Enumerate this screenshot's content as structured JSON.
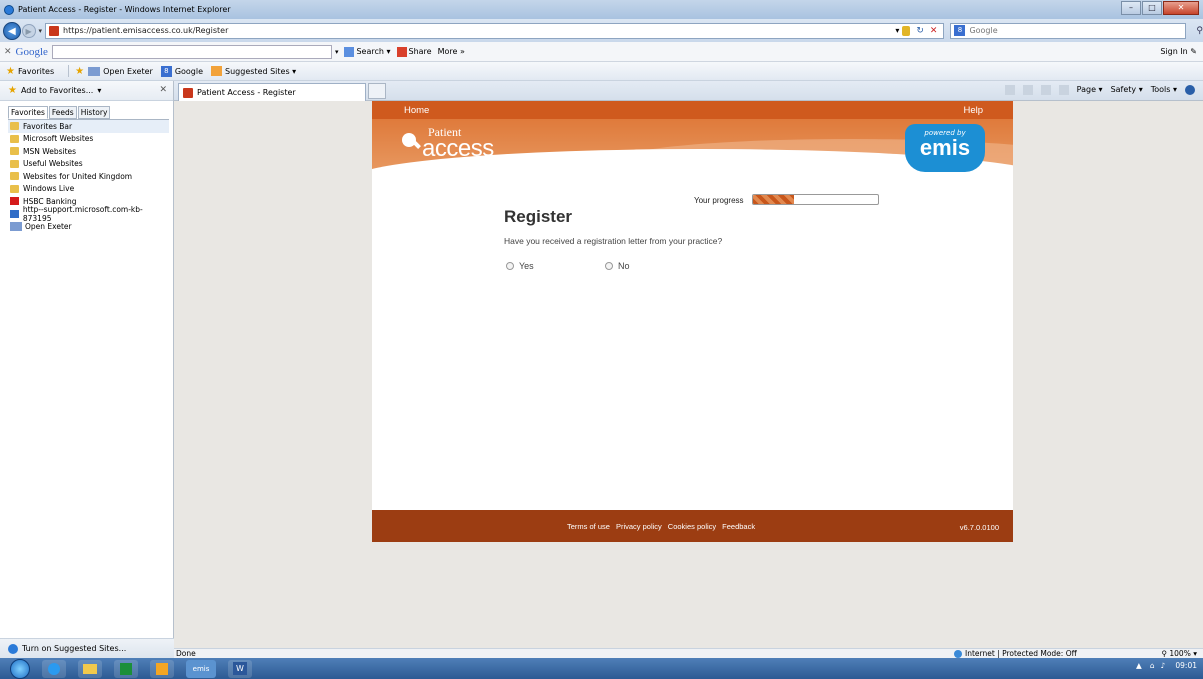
{
  "window": {
    "title": "Patient Access - Register - Windows Internet Explorer"
  },
  "address": {
    "url": "https://patient.emisaccess.co.uk/Register",
    "search_placeholder": "Google"
  },
  "google_toolbar": {
    "logo": "Google",
    "search_label": "Search",
    "share_label": "Share",
    "more_label": "More »",
    "signin_label": "Sign In"
  },
  "favorites_bar": {
    "favorites_label": "Favorites",
    "items": [
      {
        "label": "Open Exeter"
      },
      {
        "label": "Google"
      },
      {
        "label": "Suggested Sites ▾"
      }
    ]
  },
  "fav_pane": {
    "add_label": "Add to Favorites...",
    "tabs": [
      "Favorites",
      "Feeds",
      "History"
    ],
    "items": [
      {
        "label": "Favorites Bar",
        "type": "folder"
      },
      {
        "label": "Microsoft Websites",
        "type": "folder"
      },
      {
        "label": "MSN Websites",
        "type": "folder"
      },
      {
        "label": "Useful Websites",
        "type": "folder"
      },
      {
        "label": "Websites for United Kingdom",
        "type": "folder"
      },
      {
        "label": "Windows Live",
        "type": "folder"
      },
      {
        "label": "HSBC Banking",
        "type": "link"
      },
      {
        "label": "http--support.microsoft.com-kb-873195",
        "type": "link"
      },
      {
        "label": "Open Exeter",
        "type": "link"
      }
    ],
    "footer_label": "Turn on Suggested Sites..."
  },
  "tab": {
    "title": "Patient Access - Register"
  },
  "command_bar": {
    "page_label": "Page ▾",
    "safety_label": "Safety ▾",
    "tools_label": "Tools ▾"
  },
  "site": {
    "nav": {
      "home_label": "Home",
      "help_label": "Help"
    },
    "logo": {
      "patient": "Patient",
      "access": "access"
    },
    "emis_badge": {
      "powered_by": "powered by",
      "brand": "emis"
    },
    "progress": {
      "label": "Your progress",
      "value": 0.33
    },
    "title": "Register",
    "question": "Have you received a registration letter from your practice?",
    "options": {
      "yes": "Yes",
      "no": "No"
    },
    "footer": {
      "links": [
        "Terms of use",
        "Privacy policy",
        "Cookies policy",
        "Feedback"
      ],
      "version": "v6.7.0.0100"
    }
  },
  "status": {
    "text": "Done",
    "zone": "Internet | Protected Mode: Off",
    "zoom": "100%"
  },
  "taskbar": {
    "emis_label": "emis",
    "word_label": "W",
    "time": "09:01"
  }
}
